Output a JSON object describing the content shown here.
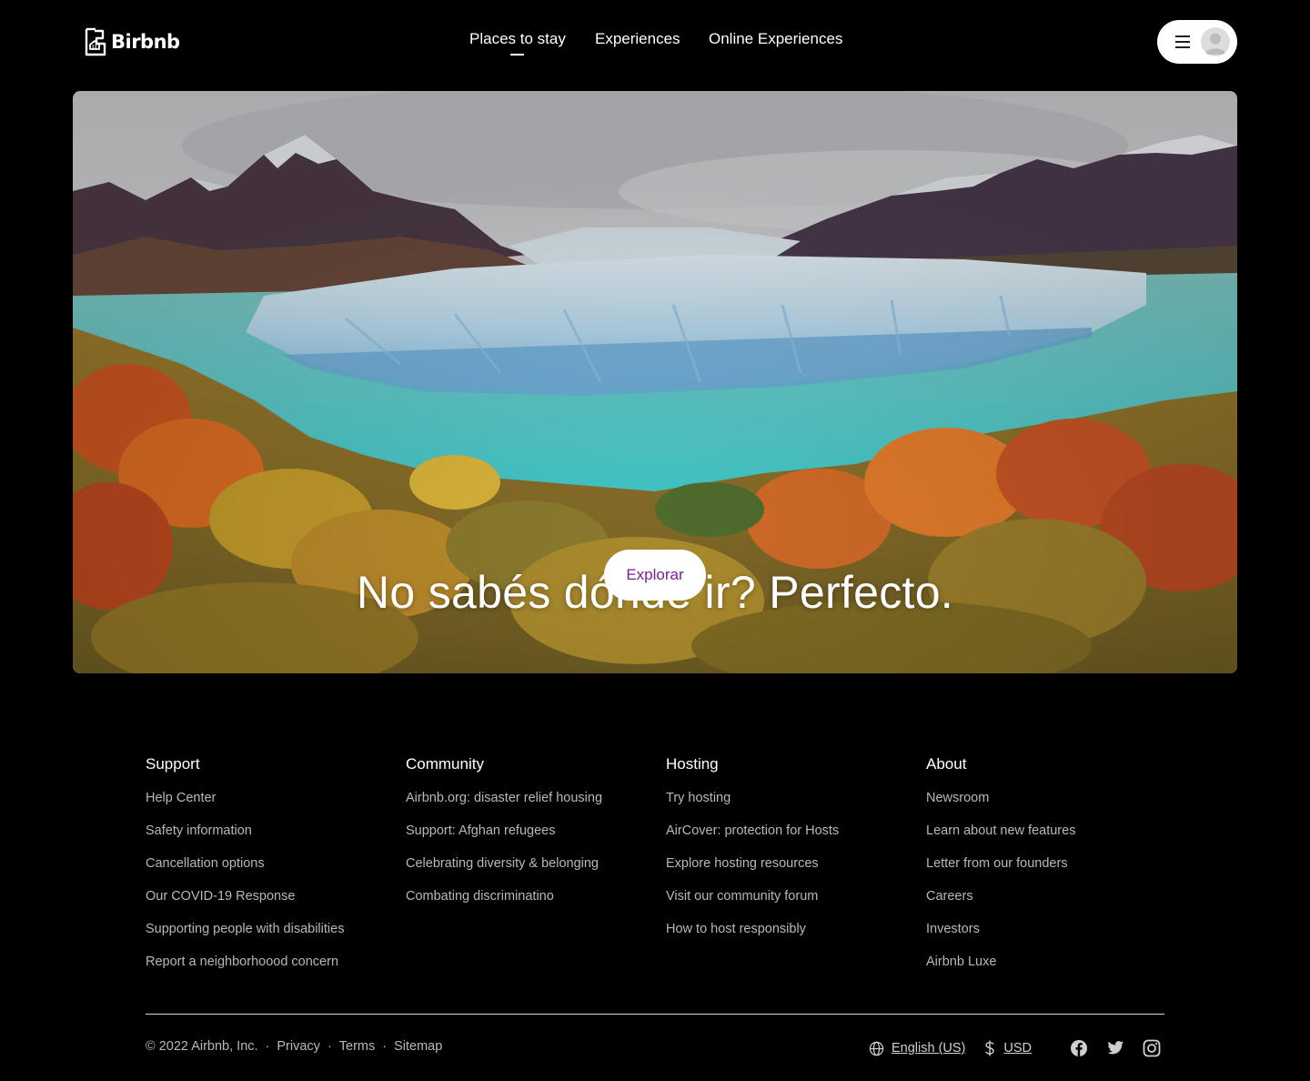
{
  "brand": {
    "name": "Birbnb"
  },
  "nav": {
    "items": [
      {
        "label": "Places to stay",
        "active": true
      },
      {
        "label": "Experiences",
        "active": false
      },
      {
        "label": "Online Experiences",
        "active": false
      }
    ]
  },
  "user_menu": {
    "menu_icon": "hamburger-icon",
    "avatar_icon": "user-avatar-icon"
  },
  "hero": {
    "title": "No sabés dónde ir? Perfecto.",
    "button_label": "Explorar"
  },
  "footer": {
    "columns": [
      {
        "title": "Support",
        "links": [
          "Help Center",
          "Safety information",
          "Cancellation options",
          "Our COVID-19 Response",
          "Supporting people with disabilities",
          "Report a neighborhoood concern"
        ]
      },
      {
        "title": "Community",
        "links": [
          "Airbnb.org: disaster relief housing",
          "Support: Afghan refugees",
          "Celebrating diversity & belonging",
          "Combating discriminatino"
        ]
      },
      {
        "title": "Hosting",
        "links": [
          "Try hosting",
          "AirCover: protection for Hosts",
          "Explore hosting resources",
          "Visit our community forum",
          "How to host responsibly"
        ]
      },
      {
        "title": "About",
        "links": [
          "Newsroom",
          "Learn about new features",
          "Letter from our founders",
          "Careers",
          "Investors",
          "Airbnb Luxe"
        ]
      }
    ],
    "copyright": "© 2022 Airbnb, Inc.",
    "legal_links": [
      "Privacy",
      "Terms",
      "Sitemap"
    ],
    "separator": "·",
    "language": "English (US)",
    "currency": "USD",
    "social_icons": [
      "facebook-icon",
      "twitter-icon",
      "instagram-icon"
    ]
  },
  "colors": {
    "background": "#000000",
    "button_text": "#7a1f96",
    "footer_link": "#b8b8b8"
  }
}
